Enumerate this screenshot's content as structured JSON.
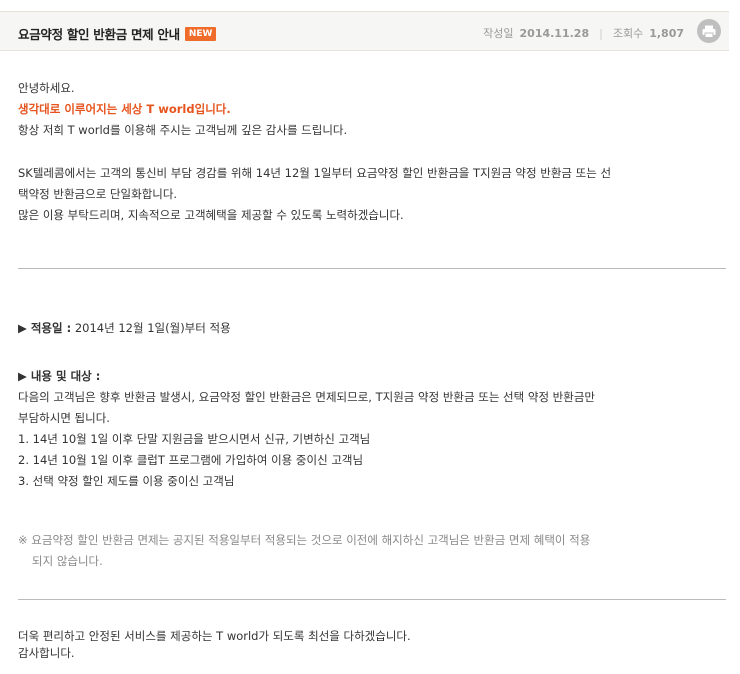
{
  "header": {
    "title": "요금약정 할인 반환금 면제 안내",
    "badge": "NEW",
    "date_label": "작성일",
    "date_value": "2014.11.28",
    "views_label": "조회수",
    "views_value": "1,807",
    "print_icon": "printer-icon"
  },
  "intro": {
    "greeting": "안녕하세요.",
    "slogan": "생각대로 이루어지는 세상 T world입니다.",
    "thanks": "항상 저희 T world를 이용해 주시는 고객님께 깊은 감사를 드립니다."
  },
  "body1": {
    "line1": "SK텔레콤에서는 고객의 통신비 부담 경감를 위해 14년 12월 1일부터 요금약정 할인 반환금을 T지원금 약정 반환금 또는 선",
    "line2": "택약정 반환금으로 단일화합니다.",
    "line3": "많은 이용 부탁드리며, 지속적으로 고객혜택을 제공할 수 있도록 노력하겠습니다."
  },
  "apply": {
    "label": "▶ 적용일 :",
    "value": "2014년 12월 1일(월)부터 적용"
  },
  "target": {
    "label": "▶ 내용 및 대상 :",
    "desc1": "다음의 고객님은 향후 반환금 발생시, 요금약정 할인 반환금은 면제되므로, T지원금 약정 반환금 또는 선택 약정 반환금만",
    "desc2": "부담하시면 됩니다.",
    "item1": "1. 14년 10월 1일 이후 단말 지원금을 받으시면서 신규, 기변하신 고객님",
    "item2": "2. 14년 10월 1일 이후 클럽T 프로그램에 가입하여 이용 중이신 고객님",
    "item3": "3. 선택 약정 할인 제도를 이용 중이신 고객님"
  },
  "note": {
    "line1": "※ 요금약정 할인 반환금 면제는 공지된 적용일부터 적용되는 것으로 이전에 해지하신 고객님은 반환금 면제 혜택이 적용",
    "line2": "되지 않습니다."
  },
  "closing": {
    "line1": "더욱 편리하고 안정된 서비스를 제공하는 T world가 되도록 최선을 다하겠습니다.",
    "line2": "감사합니다."
  }
}
